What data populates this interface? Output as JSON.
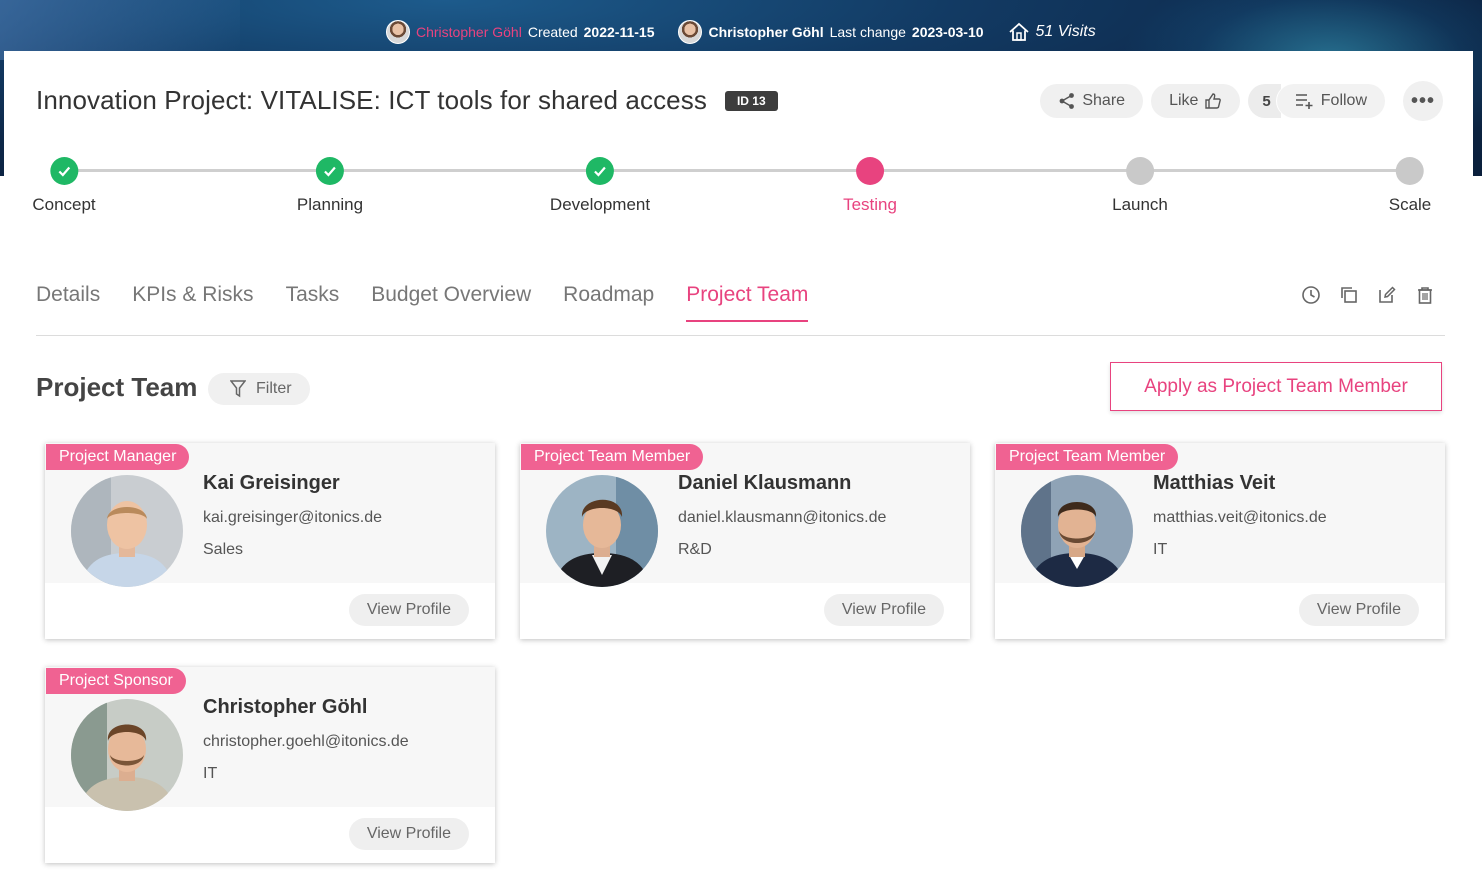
{
  "meta": {
    "creator_name": "Christopher Göhl",
    "created_label": "Created",
    "created_date": "2022-11-15",
    "editor_name": "Christopher Göhl",
    "last_change_label": "Last change",
    "last_change_date": "2023-03-10",
    "visits": "51 Visits"
  },
  "header": {
    "title": "Innovation Project: VITALISE: ICT tools for shared access",
    "id_badge": "ID 13"
  },
  "actions": {
    "share": "Share",
    "like": "Like",
    "follow_count": "5",
    "follow": "Follow",
    "more": "•••"
  },
  "stages": [
    {
      "label": "Concept",
      "status": "done"
    },
    {
      "label": "Planning",
      "status": "done"
    },
    {
      "label": "Development",
      "status": "done"
    },
    {
      "label": "Testing",
      "status": "current"
    },
    {
      "label": "Launch",
      "status": "todo"
    },
    {
      "label": "Scale",
      "status": "todo"
    }
  ],
  "tabs": [
    {
      "label": "Details"
    },
    {
      "label": "KPIs & Risks"
    },
    {
      "label": "Tasks"
    },
    {
      "label": "Budget Overview"
    },
    {
      "label": "Roadmap"
    },
    {
      "label": "Project Team",
      "active": true
    }
  ],
  "section": {
    "title": "Project Team",
    "filter": "Filter",
    "apply": "Apply as Project Team Member"
  },
  "members": [
    {
      "role": "Project Manager",
      "name": "Kai Greisinger",
      "email": "kai.greisinger@itonics.de",
      "department": "Sales",
      "button": "View Profile"
    },
    {
      "role": "Project Team Member",
      "name": "Daniel Klausmann",
      "email": "daniel.klausmann@itonics.de",
      "department": "R&D",
      "button": "View Profile"
    },
    {
      "role": "Project Team Member",
      "name": "Matthias Veit",
      "email": "matthias.veit@itonics.de",
      "department": "IT",
      "button": "View Profile"
    },
    {
      "role": "Project Sponsor",
      "name": "Christopher Göhl",
      "email": "christopher.goehl@itonics.de",
      "department": "IT",
      "button": "View Profile"
    }
  ],
  "colors": {
    "accent": "#e8437f",
    "done": "#1fb865",
    "todo": "#c9c9c9",
    "badge": "#f06292"
  }
}
